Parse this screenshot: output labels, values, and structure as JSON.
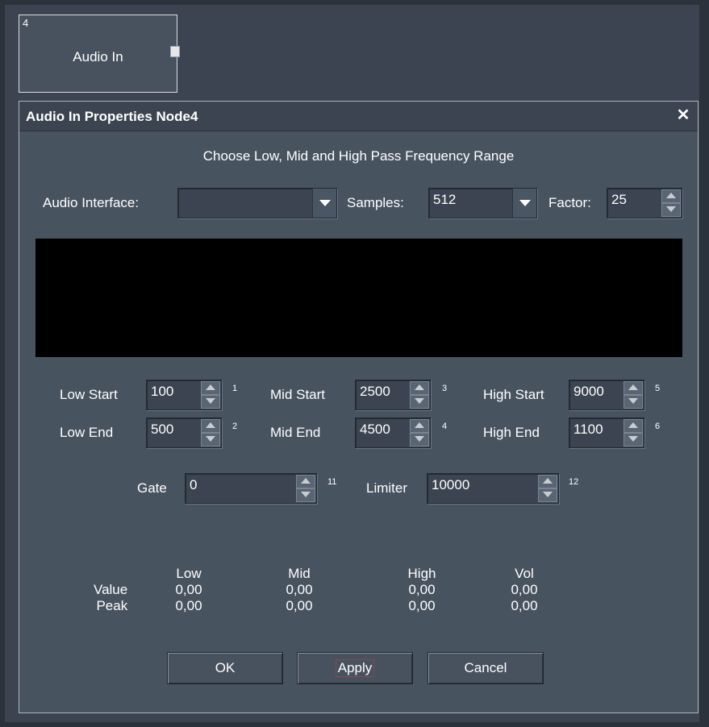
{
  "node": {
    "id": "4",
    "label": "Audio In"
  },
  "dialog": {
    "title": "Audio In Properties Node4",
    "heading": "Choose Low, Mid and High Pass Frequency Range",
    "audio_interface_label": "Audio Interface:",
    "audio_interface_value": "",
    "samples_label": "Samples:",
    "samples_value": "512",
    "factor_label": "Factor:",
    "factor_value": "25",
    "bands": {
      "low_start": {
        "label": "Low Start",
        "value": "100",
        "index": "1"
      },
      "low_end": {
        "label": "Low End",
        "value": "500",
        "index": "2"
      },
      "mid_start": {
        "label": "Mid Start",
        "value": "2500",
        "index": "3"
      },
      "mid_end": {
        "label": "Mid End",
        "value": "4500",
        "index": "4"
      },
      "high_start": {
        "label": "High Start",
        "value": "9000",
        "index": "5"
      },
      "high_end": {
        "label": "High End",
        "value": "1100",
        "index": "6"
      }
    },
    "gate": {
      "label": "Gate",
      "value": "0",
      "index": "11"
    },
    "limiter": {
      "label": "Limiter",
      "value": "10000",
      "index": "12"
    },
    "readout": {
      "columns": [
        "Low",
        "Mid",
        "High",
        "Vol"
      ],
      "row_labels": [
        "Value",
        "Peak"
      ],
      "values": [
        "0,00",
        "0,00",
        "0,00",
        "0,00"
      ],
      "peaks": [
        "0,00",
        "0,00",
        "0,00",
        "0,00"
      ]
    },
    "buttons": {
      "ok": "OK",
      "apply": "Apply",
      "cancel": "Cancel"
    }
  },
  "colors": {
    "background": "#2c323c",
    "dialog": "#485360",
    "display": "#000000"
  },
  "icons": {
    "close": "close-icon",
    "dropdown": "chevron-down-icon",
    "spin": "spinner-arrows-icon"
  }
}
